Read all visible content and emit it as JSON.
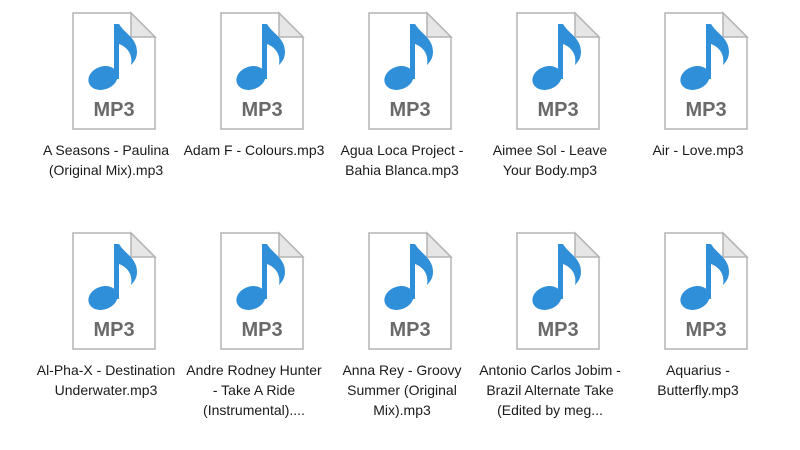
{
  "icon": {
    "name": "mp3-music-file-icon",
    "badge_text": "MP3",
    "page_color": "#ffffff",
    "page_border": "#b4b4b4",
    "fold_color": "#e6e6e6",
    "note_color": "#2f8fd8",
    "badge_color": "#6a6a6a"
  },
  "files": [
    {
      "label": "A Seasons - Paulina (Original Mix).mp3"
    },
    {
      "label": "Adam F - Colours.mp3"
    },
    {
      "label": "Agua Loca Project - Bahia Blanca.mp3"
    },
    {
      "label": "Aimee Sol - Leave Your Body.mp3"
    },
    {
      "label": "Air - Love.mp3"
    },
    {
      "label": "Al-Pha-X - Destination Underwater.mp3"
    },
    {
      "label": "Andre Rodney Hunter - Take A Ride (Instrumental)...."
    },
    {
      "label": "Anna Rey - Groovy Summer (Original Mix).mp3"
    },
    {
      "label": "Antonio Carlos Jobim - Brazil Alternate Take (Edited by meg..."
    },
    {
      "label": "Aquarius - Butterfly.mp3"
    }
  ]
}
